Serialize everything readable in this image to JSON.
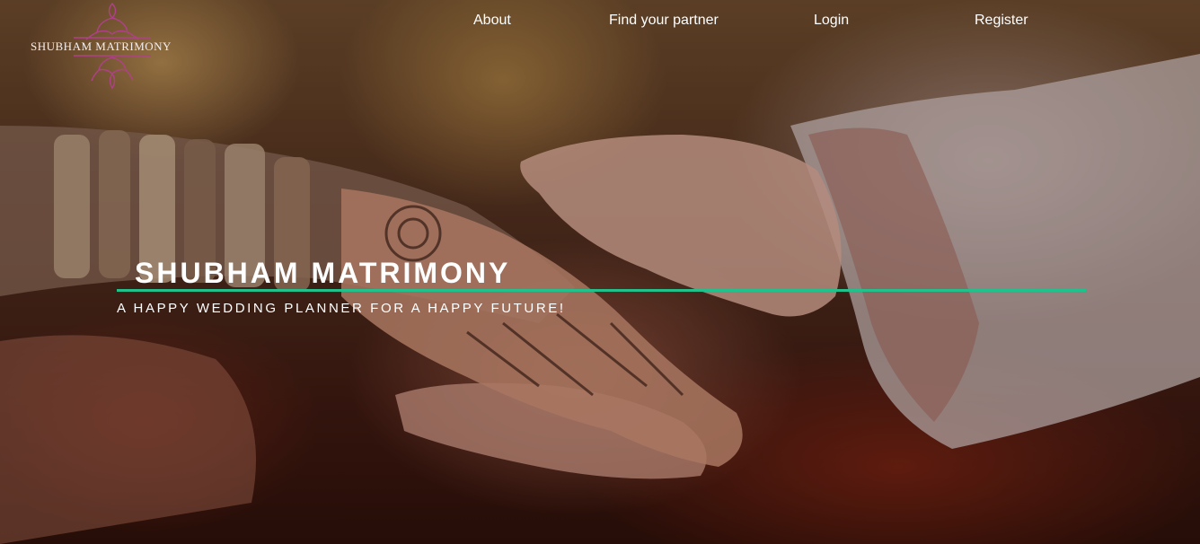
{
  "logo": {
    "text": "SHUBHAM MATRIMONY",
    "icon": "ornament-icon",
    "color": "#b0408a"
  },
  "nav": {
    "items": [
      {
        "label": "About"
      },
      {
        "label": "Find your partner"
      },
      {
        "label": "Login"
      },
      {
        "label": "Register"
      }
    ]
  },
  "hero": {
    "title": "SHUBHAM MATRIMONY",
    "subtitle": "A HAPPY WEDDING PLANNER FOR A HAPPY FUTURE!",
    "accent_color": "#22c08a",
    "image": "wedding-hands-photo"
  }
}
